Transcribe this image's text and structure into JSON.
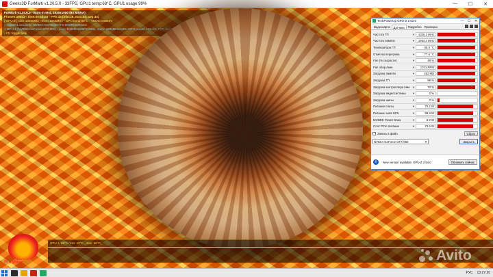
{
  "window": {
    "title": "Geeks3D FurMark v1.20.5.0 - 33FPS, GPU1 temp:68°C, GPU1 usage:99%",
    "minimize": "—",
    "maximize": "☐",
    "close": "✕"
  },
  "hud": {
    "line1": "FurMark v1.20.5.0 - Burn-in test, 1920x1080 (8X MSAA)",
    "line2": "Frames:29843 - time:00:15:04 - FPS:33 (min:28, max:34, avg:33)",
    "line3": "[ GPU-Z ] core:1025MHz - mem:1652MHz - GPU temp:68°C - VDDC:0.9560V",
    "line4": "> OpenGL renderer: NVIDIA GeForce GTX 950/PCIe/SSE2",
    "line5": "> GPU 1 (NVIDIA GeForce GTX 950) - core: 1025MHz/68°C/99%, mem: 3304MHz/13%, GPU power: 101.2% TDP, fan: 48%, limits:[power:1, temp:0, volt:0, OV:0]",
    "line6": "- F1: toggle help"
  },
  "graph": {
    "label": "GPU 1: 68°C (min: 49°C - max: 68°C)"
  },
  "furmark_logo": "FurMark",
  "avito": "Avito",
  "gpuz": {
    "title": "TechPowerUp GPU-Z 2.52.0",
    "tabs": [
      "Видеокарта",
      "Датчики",
      "Подробно",
      "Проверка"
    ],
    "sensors": [
      {
        "label": "Частота ГП",
        "value": "1025.2 MHz",
        "level": 0.95
      },
      {
        "label": "Частота памяти",
        "value": "1652.4 MHz",
        "level": 0.95
      },
      {
        "label": "Температура ГП",
        "value": "68.0 °C",
        "level": 0.95
      },
      {
        "label": "Отметка перегрева",
        "value": "77.6 °C",
        "level": 0.95
      },
      {
        "label": "Fan (% скорости)",
        "value": "48 %",
        "level": 0.95
      },
      {
        "label": "Fan обор./мин.",
        "value": "1701 RPM",
        "level": 0.95
      },
      {
        "label": "Загрузка памяти",
        "value": "252 MB",
        "level": 0.95
      },
      {
        "label": "Загрузка ГП",
        "value": "99 %",
        "level": 0.95
      },
      {
        "label": "Загрузка контроллера пам.",
        "value": "70 %",
        "level": 0.95
      },
      {
        "label": "Загрузка видеосистемы",
        "value": "0 %",
        "level": 0
      },
      {
        "label": "Загрузка шины",
        "value": "2 %",
        "level": 0.05
      },
      {
        "label": "Питание платы",
        "value": "79.2 W",
        "level": 0.9
      },
      {
        "label": "Питание чипа GPU",
        "value": "58.9 W",
        "level": 0.9
      },
      {
        "label": "MVDDC Power Draw",
        "value": "8.9 W",
        "level": 0.9
      },
      {
        "label": "Слот PCIe питание",
        "value": "73.6 W",
        "level": 0.9
      }
    ],
    "log_label": "Запись в файл",
    "reset_button": "Сброс",
    "gpu_select": "NVIDIA GeForce GTX 950",
    "close_button": "Закрыть"
  },
  "notice": {
    "text": "New version available: GPU-Z 2.54.0",
    "button": "Обновить сейчас"
  },
  "taskbar": {
    "lang": "РУС",
    "time": "13:27:20"
  },
  "colors": {
    "graph_bar": "#d80000",
    "accent": "#1f5fc6"
  }
}
